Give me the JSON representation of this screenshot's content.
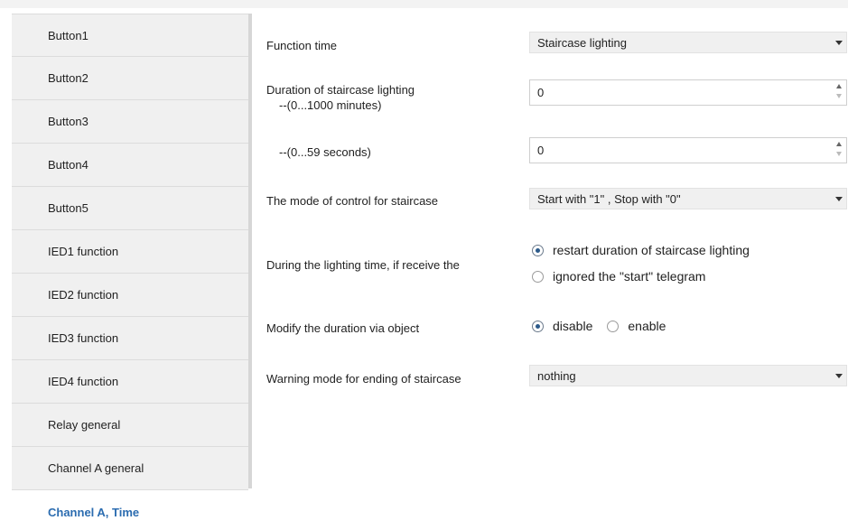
{
  "sidebar": {
    "items": [
      {
        "label": "Button1"
      },
      {
        "label": "Button2"
      },
      {
        "label": "Button3"
      },
      {
        "label": "Button4"
      },
      {
        "label": "Button5"
      },
      {
        "label": "IED1 function"
      },
      {
        "label": "IED2 function"
      },
      {
        "label": "IED3 function"
      },
      {
        "label": "IED4 function"
      },
      {
        "label": "Relay general"
      },
      {
        "label": "Channel A general"
      },
      {
        "label": "Channel A, Time"
      }
    ],
    "active_index": 11
  },
  "form": {
    "function_time": {
      "label": "Function time",
      "value": "Staircase lighting"
    },
    "duration_minutes": {
      "label": "Duration of staircase lighting",
      "sublabel": "--(0...1000 minutes)",
      "value": "0"
    },
    "duration_seconds": {
      "sublabel": "--(0...59 seconds)",
      "value": "0"
    },
    "control_mode": {
      "label": "The mode of control for staircase",
      "value": "Start with \"1\" , Stop with \"0\""
    },
    "retrigger": {
      "label": "During the lighting time, if receive the",
      "options": [
        "restart duration of staircase lighting",
        "ignored the \"start\" telegram"
      ],
      "selected": 0
    },
    "modify_duration": {
      "label": "Modify the duration via object",
      "options": [
        "disable",
        "enable"
      ],
      "selected": 0
    },
    "warning_mode": {
      "label": "Warning mode for ending of staircase",
      "value": "nothing"
    }
  },
  "colors": {
    "accent": "#2b6cb0",
    "sidebar_bg": "#f0f0f0",
    "dropdown_bg": "#f0f0f0"
  }
}
